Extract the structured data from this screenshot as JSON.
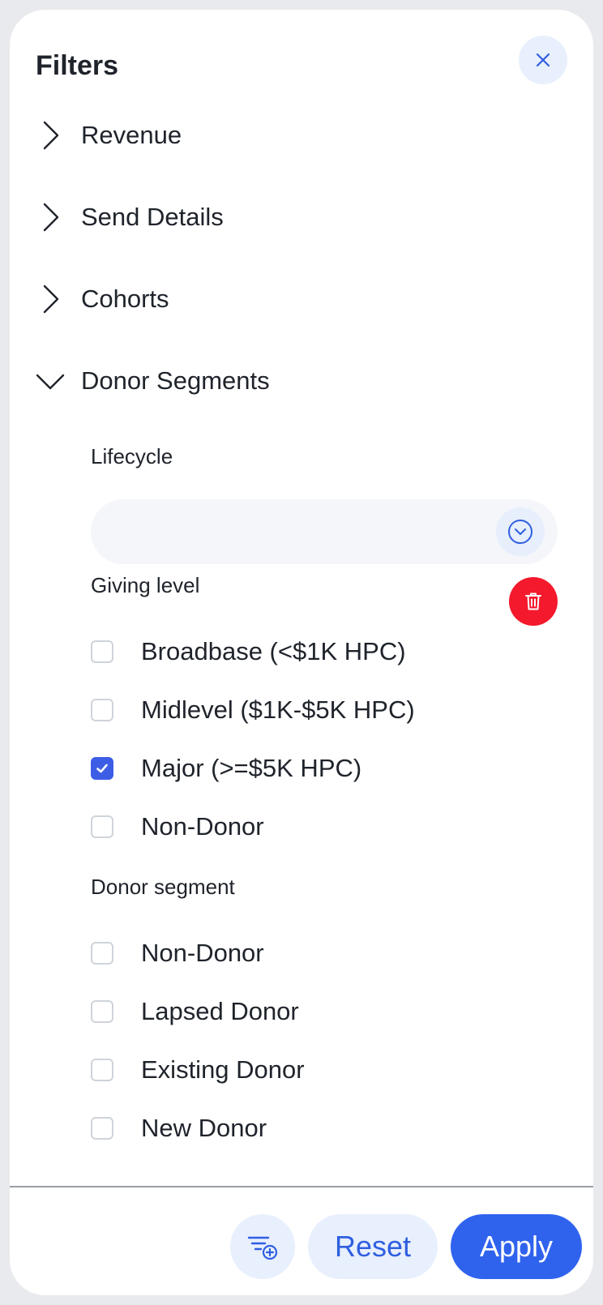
{
  "header": {
    "title": "Filters"
  },
  "sections": [
    {
      "label": "Revenue",
      "expanded": false
    },
    {
      "label": "Send Details",
      "expanded": false
    },
    {
      "label": "Cohorts",
      "expanded": false
    },
    {
      "label": "Donor Segments",
      "expanded": true
    }
  ],
  "donor_segments": {
    "lifecycle": {
      "label": "Lifecycle",
      "value": ""
    },
    "giving_level": {
      "label": "Giving level",
      "options": [
        {
          "label": "Broadbase (<$1K HPC)",
          "checked": false
        },
        {
          "label": "Midlevel ($1K-$5K HPC)",
          "checked": false
        },
        {
          "label": "Major (>=$5K HPC)",
          "checked": true
        },
        {
          "label": "Non-Donor",
          "checked": false
        }
      ]
    },
    "donor_segment": {
      "label": "Donor segment",
      "options": [
        {
          "label": "Non-Donor",
          "checked": false
        },
        {
          "label": "Lapsed Donor",
          "checked": false
        },
        {
          "label": "Existing Donor",
          "checked": false
        },
        {
          "label": "New Donor",
          "checked": false
        }
      ]
    }
  },
  "footer": {
    "reset_label": "Reset",
    "apply_label": "Apply"
  },
  "colors": {
    "accent": "#2f63ee",
    "accent_soft": "#e8effd",
    "danger": "#f4192c",
    "checkbox_checked": "#3d5de6"
  },
  "icons": {
    "close": "close-icon",
    "collapsed": "chevron-right-icon",
    "expanded": "chevron-down-icon",
    "dropdown": "chevron-down-circle-icon",
    "delete": "trash-icon",
    "add_filter": "filter-add-icon",
    "check": "checkmark-icon"
  }
}
